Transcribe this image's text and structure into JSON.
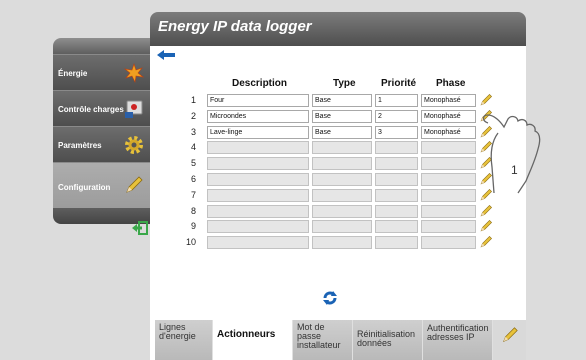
{
  "header": {
    "title": "Energy IP data logger"
  },
  "sidebar": {
    "items": [
      {
        "label": "Énergie",
        "icon": "energy-burst-icon",
        "active": false
      },
      {
        "label": "Contrôle charges",
        "icon": "load-control-icon",
        "active": false
      },
      {
        "label": "Paramètres",
        "icon": "gear-icon",
        "active": false
      },
      {
        "label": "Configuration",
        "icon": "pencil-icon",
        "active": true
      }
    ]
  },
  "table": {
    "headers": {
      "description": "Description",
      "type": "Type",
      "priority": "Priorité",
      "phase": "Phase"
    },
    "rows": [
      {
        "num": "1",
        "description": "Four",
        "type": "Base",
        "priority": "1",
        "phase": "Monophasé"
      },
      {
        "num": "2",
        "description": "Microondes",
        "type": "Base",
        "priority": "2",
        "phase": "Monophasé"
      },
      {
        "num": "3",
        "description": "Lave-linge",
        "type": "Base",
        "priority": "3",
        "phase": "Monophasé"
      },
      {
        "num": "4",
        "description": "",
        "type": "",
        "priority": "",
        "phase": ""
      },
      {
        "num": "5",
        "description": "",
        "type": "",
        "priority": "",
        "phase": ""
      },
      {
        "num": "6",
        "description": "",
        "type": "",
        "priority": "",
        "phase": ""
      },
      {
        "num": "7",
        "description": "",
        "type": "",
        "priority": "",
        "phase": ""
      },
      {
        "num": "8",
        "description": "",
        "type": "",
        "priority": "",
        "phase": ""
      },
      {
        "num": "9",
        "description": "",
        "type": "",
        "priority": "",
        "phase": ""
      },
      {
        "num": "10",
        "description": "",
        "type": "",
        "priority": "",
        "phase": ""
      }
    ]
  },
  "callout": {
    "number": "1"
  },
  "tabs": [
    {
      "label": "Lignes d'energie",
      "active": false
    },
    {
      "label": "Actionneurs",
      "active": true
    },
    {
      "label": "Mot de passe installateur",
      "active": false
    },
    {
      "label": "Réinitialisation données",
      "active": false
    },
    {
      "label": "Authentification adresses IP",
      "active": false
    }
  ],
  "colors": {
    "accent_blue": "#1a63b5",
    "pencil_yellow": "#e8c23a",
    "exit_green": "#3aa84a"
  }
}
